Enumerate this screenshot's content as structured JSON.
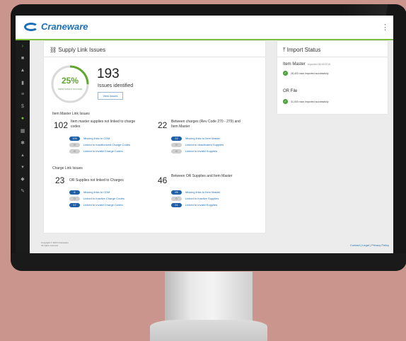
{
  "app": {
    "logo_text": "Craneware",
    "accent_color": "#7bbf3a",
    "brand_color": "#1e6fb6",
    "menu_icon": "kebab-icon"
  },
  "sidebar": {
    "icons": [
      "chevron-right-icon",
      "home-icon",
      "user-icon",
      "chart-icon",
      "list-icon",
      "dollar-icon",
      "link-icon",
      "grid-icon",
      "gear-icon",
      "upload-icon",
      "filter-icon",
      "tag-icon",
      "edit-icon"
    ]
  },
  "supply": {
    "title": "Supply Link Issues",
    "donut_percent_value": 25,
    "donut_percent": "25%",
    "donut_sub": "Valid linked records",
    "issues_count": "193",
    "issues_label": "Issues identified",
    "view_button": "View issues",
    "item_master_section": "Item Master Link Issues",
    "charge_section": "Charge Link Issues",
    "groups": [
      {
        "num": "102",
        "label": "Item master supplies not linked to charge codes",
        "rows": [
          {
            "badge": "100",
            "style": "blue",
            "text": "Missing links to CDM"
          },
          {
            "badge": "0",
            "style": "grey",
            "text": "Linked to inauthorized Charge Codes"
          },
          {
            "badge": "0",
            "style": "grey",
            "text": "Linked to invalid Charge Codes"
          }
        ]
      },
      {
        "num": "22",
        "label": "Between charges (Rev Code 270 - 279) and Item Master",
        "rows": [
          {
            "badge": "22",
            "style": "blue",
            "text": "Missing links to Item Master"
          },
          {
            "badge": "0",
            "style": "grey",
            "text": "Linked to deactivated Supplies"
          },
          {
            "badge": "0",
            "style": "grey",
            "text": "Linked to invalid Supplies"
          }
        ]
      },
      {
        "num": "23",
        "label": "OR Supplies not linked to Charges",
        "rows": [
          {
            "badge": "6",
            "style": "blue",
            "text": "Missing links to CDM"
          },
          {
            "badge": "0",
            "style": "grey",
            "text": "Linked to inactive Charge Codes"
          },
          {
            "badge": "17",
            "style": "blue",
            "text": "Linked to invalid Charge Codes"
          }
        ]
      },
      {
        "num": "46",
        "label": "Between OR Supplies and Item Master",
        "rows": [
          {
            "badge": "25",
            "style": "blue",
            "text": "Missing links to Item Master"
          },
          {
            "badge": "0",
            "style": "grey",
            "text": "Linked to inactive Supplies"
          },
          {
            "badge": "21",
            "style": "blue",
            "text": "Linked to invalid Supplies"
          }
        ]
      }
    ]
  },
  "import": {
    "title": "Import Status",
    "item_master": {
      "title": "Item Master",
      "sub": "Imported 06/10/2016",
      "status": "28,403 rows imported successfully"
    },
    "or_file": {
      "title": "OR File",
      "status": "31,000 rows imported successfully"
    }
  },
  "footer": {
    "copyright": "Copyright © 2016 Craneware",
    "rights": "All rights reserved",
    "links": "Contact | Legal | Privacy Policy"
  }
}
